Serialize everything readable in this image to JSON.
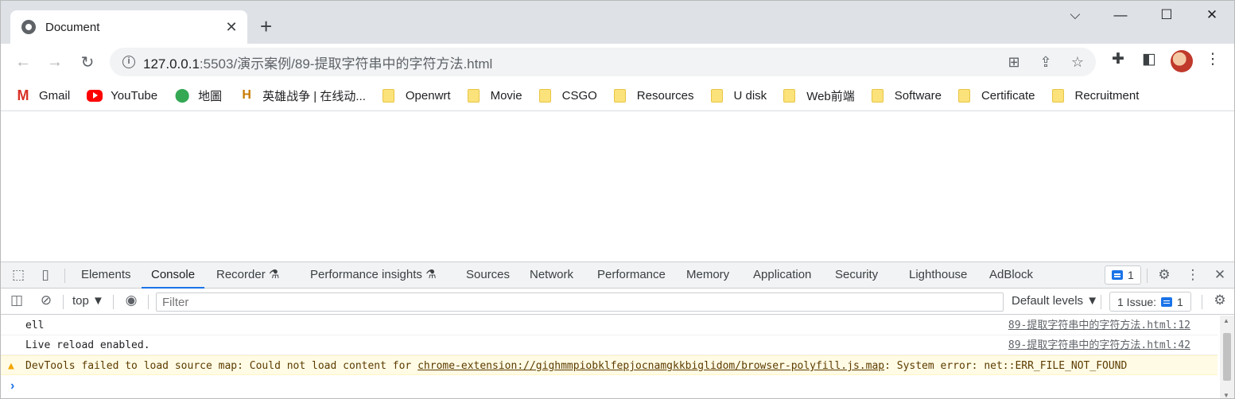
{
  "tab": {
    "title": "Document",
    "close": "✕"
  },
  "window_controls": {
    "dropdown": "⌵",
    "minimize": "—",
    "maximize": "☐",
    "close": "✕"
  },
  "toolbar": {
    "back": "←",
    "forward": "→",
    "reload": "↻",
    "url_host": "127.0.0.1",
    "url_rest": ":5503/演示案例/89-提取字符串中的字符方法.html",
    "site_info_icon": "i"
  },
  "bookmarks": [
    {
      "label": "Gmail",
      "icon": "gmail-icon"
    },
    {
      "label": "YouTube",
      "icon": "youtube-icon"
    },
    {
      "label": "地圖",
      "icon": "maps-pin-icon"
    },
    {
      "label": "英雄战争 | 在线动...",
      "icon": "game-icon"
    },
    {
      "label": "Openwrt",
      "icon": "folder-icon"
    },
    {
      "label": "Movie",
      "icon": "folder-icon"
    },
    {
      "label": "CSGO",
      "icon": "folder-icon"
    },
    {
      "label": "Resources",
      "icon": "folder-icon"
    },
    {
      "label": "U disk",
      "icon": "folder-icon"
    },
    {
      "label": "Web前端",
      "icon": "folder-icon"
    },
    {
      "label": "Software",
      "icon": "folder-icon"
    },
    {
      "label": "Certificate",
      "icon": "folder-icon"
    },
    {
      "label": "Recruitment",
      "icon": "folder-icon"
    }
  ],
  "devtools": {
    "tabs": [
      {
        "label": "Elements"
      },
      {
        "label": "Console",
        "active": true
      },
      {
        "label": "Recorder ⚗"
      },
      {
        "label": "Performance insights ⚗"
      },
      {
        "label": "Sources"
      },
      {
        "label": "Network"
      },
      {
        "label": "Performance"
      },
      {
        "label": "Memory"
      },
      {
        "label": "Application"
      },
      {
        "label": "Security"
      },
      {
        "label": "Lighthouse"
      },
      {
        "label": "AdBlock"
      }
    ],
    "message_count": "1",
    "context": "top ▼",
    "filter_placeholder": "Filter",
    "default_levels": "Default levels ▼",
    "issues_label": "1 Issue:",
    "issues_count": "1",
    "console": [
      {
        "text": "ell",
        "source": "89-提取字符串中的字符方法.html:12"
      },
      {
        "text": "Live reload enabled.",
        "source": "89-提取字符串中的字符方法.html:42"
      }
    ],
    "warning": {
      "prefix": "DevTools failed to load source map: Could not load content for ",
      "link": "chrome-extension://gighmmpiobklfepjocnamgkkbiglidom/browser-polyfill.js.map",
      "suffix": ": System error: net::ERR_FILE_NOT_FOUND"
    },
    "prompt": "›"
  },
  "colors": {
    "accent": "#1a73e8",
    "tabstrip": "#dee1e6",
    "warning_bg": "#fffbe5"
  }
}
